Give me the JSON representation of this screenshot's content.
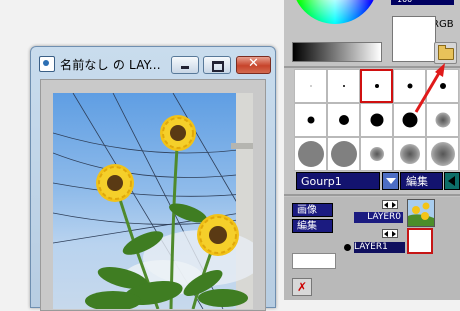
{
  "document_window": {
    "title": "名前なし の LAY...",
    "close_glyph": "✕"
  },
  "tool_panel": {
    "value_field": "100",
    "rgb_label": "RGB",
    "group_select": "Gourp1",
    "edit_button": "編集",
    "image_button": "画像",
    "layer_edit_button": "編集",
    "layers": [
      {
        "name": "LAYER0"
      },
      {
        "name": "LAYER1"
      }
    ],
    "delete_glyph": "✗"
  },
  "brushes": [
    {
      "size": 1,
      "soft": false
    },
    {
      "size": 2,
      "soft": false
    },
    {
      "size": 4,
      "soft": false,
      "selected": true
    },
    {
      "size": 5,
      "soft": false
    },
    {
      "size": 6,
      "soft": false
    },
    {
      "size": 7,
      "soft": false
    },
    {
      "size": 10,
      "soft": false
    },
    {
      "size": 13,
      "soft": false
    },
    {
      "size": 15,
      "soft": false
    },
    {
      "size": 15,
      "soft": true
    },
    {
      "size": 26,
      "soft": false
    },
    {
      "size": 26,
      "soft": false
    },
    {
      "size": 14,
      "soft": true
    },
    {
      "size": 20,
      "soft": true
    },
    {
      "size": 24,
      "soft": true
    }
  ],
  "colors": {
    "selected_brush_border": "#d01010",
    "annotation_arrow": "#e01a1a",
    "panel_button_bg": "#13136f"
  }
}
